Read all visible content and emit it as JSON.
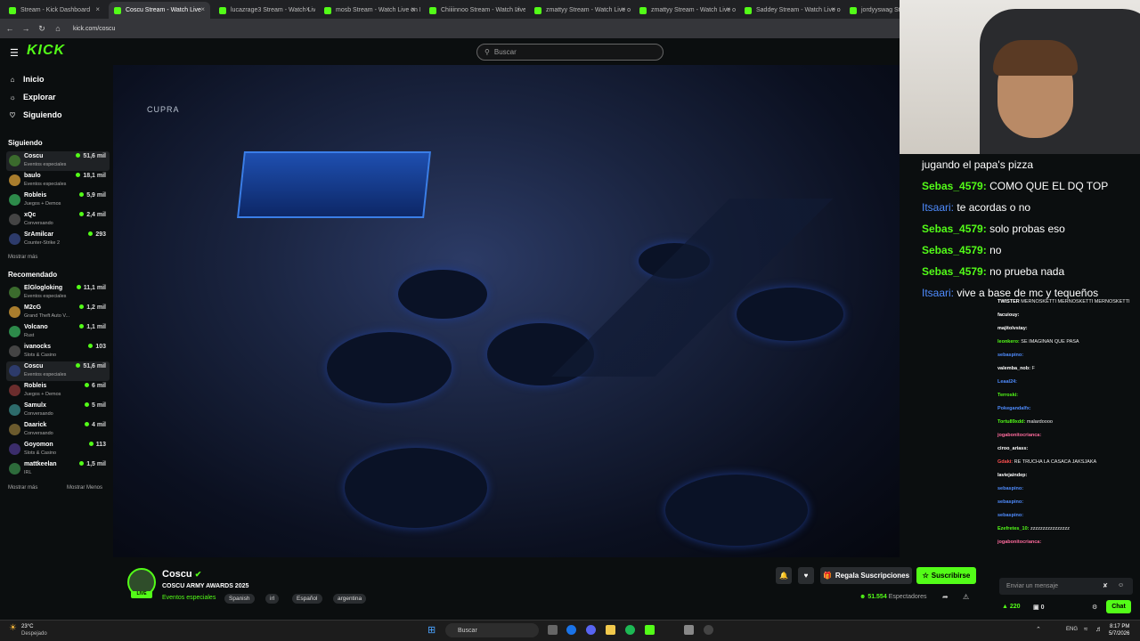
{
  "browser": {
    "tabs": [
      {
        "label": "Stream - Kick Dashboard",
        "active": false
      },
      {
        "label": "Coscu Stream - Watch Live",
        "active": true
      },
      {
        "label": "lucazrage3 Stream - Watch Live",
        "active": false
      },
      {
        "label": "mosb Stream - Watch Live on K",
        "active": false
      },
      {
        "label": "Chiiiinnoo Stream - Watch Live",
        "active": false
      },
      {
        "label": "zmattyy Stream - Watch Live o",
        "active": false
      },
      {
        "label": "zmattyy Stream - Watch Live o",
        "active": false
      },
      {
        "label": "Saddey Stream - Watch Live o",
        "active": false
      },
      {
        "label": "jordyyswag St",
        "active": false
      }
    ],
    "url": "kick.com/coscu"
  },
  "header": {
    "logo": "KICK",
    "search_placeholder": "Buscar"
  },
  "sidebar": {
    "nav": [
      {
        "label": "Inicio",
        "icon": "home-icon"
      },
      {
        "label": "Explorar",
        "icon": "compass-icon"
      },
      {
        "label": "Siguiendo",
        "icon": "heart-icon"
      }
    ],
    "following_title": "Siguiendo",
    "following": [
      {
        "name": "Coscu",
        "category": "Eventos especiales",
        "viewers": "51,6 mil",
        "selected": true
      },
      {
        "name": "baulo",
        "category": "Eventos especiales",
        "viewers": "18,1 mil"
      },
      {
        "name": "Robleis",
        "category": "Juegos + Demos",
        "viewers": "5,9 mil"
      },
      {
        "name": "xQc",
        "category": "Conversando",
        "viewers": "2,4 mil"
      },
      {
        "name": "SrAmilcar",
        "category": "Counter-Strike 2",
        "viewers": "293"
      }
    ],
    "show_more": "Mostrar más",
    "recommended_title": "Recomendado",
    "recommended": [
      {
        "name": "ElGlogloking",
        "category": "Eventos especiales",
        "viewers": "11,1 mil"
      },
      {
        "name": "M2cG",
        "category": "Grand Theft Auto V...",
        "viewers": "1,2 mil"
      },
      {
        "name": "Volcano",
        "category": "Rust",
        "viewers": "1,1 mil"
      },
      {
        "name": "ivanocks",
        "category": "Slots & Casino",
        "viewers": "103"
      },
      {
        "name": "Coscu",
        "category": "Eventos especiales",
        "viewers": "51,6 mil",
        "selected": true
      },
      {
        "name": "Robleis",
        "category": "Juegos + Demos",
        "viewers": "6 mil"
      },
      {
        "name": "Samulx",
        "category": "Conversando",
        "viewers": "5 mil"
      },
      {
        "name": "Daarick",
        "category": "Conversando",
        "viewers": "4 mil"
      },
      {
        "name": "Goyomon",
        "category": "Slots & Casino",
        "viewers": "113"
      },
      {
        "name": "mattkeelan",
        "category": "IRL",
        "viewers": "1,5 mil"
      }
    ],
    "show_more2": "Mostrar más",
    "show_less": "Mostrar Menos"
  },
  "video": {
    "watermark": "CUPRA"
  },
  "stream": {
    "name": "Coscu",
    "title": "COSCU ARMY AWARDS 2025",
    "category": "Eventos especiales",
    "tags": [
      "Spanish",
      "irl",
      "Español",
      "argentina"
    ],
    "gift_label": "Regala Suscripciones",
    "subscribe_label": "Suscribirse",
    "viewers": "51.554",
    "viewers_label": "Espectadores"
  },
  "chat_overlay": [
    {
      "user": "",
      "text": "jugando el papa's pizza"
    },
    {
      "user": "Sebas_4579:",
      "text": "COMO QUE EL DQ TOP"
    },
    {
      "user": "Itsaari:",
      "text": "te acordas o no"
    },
    {
      "user": "Sebas_4579:",
      "text": "solo probas eso"
    },
    {
      "user": "Sebas_4579:",
      "text": "no"
    },
    {
      "user": "Sebas_4579:",
      "text": "no prueba nada"
    },
    {
      "user": "Itsaari:",
      "text": "vive a base de mc y tequeños"
    }
  ],
  "chat": {
    "messages": [
      {
        "user": "TWISTER",
        "text": "MERNOSKETTI MERNOSKETTI MERNOSKETTI",
        "color": "#ffffff"
      },
      {
        "user": "facuiouy:",
        "text": "",
        "color": "#ffffff"
      },
      {
        "user": "majitolvstay:",
        "text": "",
        "color": "#ffffff"
      },
      {
        "user": "leonkero:",
        "text": "SE IMAGINAN QUE PASA",
        "color": "#53fc18"
      },
      {
        "user": "sebaspino:",
        "text": "",
        "color": "#4f8cff"
      },
      {
        "user": "valemba_nob:",
        "text": "F",
        "color": "#ffffff"
      },
      {
        "user": "Leaal24:",
        "text": "",
        "color": "#4f8cff"
      },
      {
        "user": "Terroski:",
        "text": "",
        "color": "#53fc18"
      },
      {
        "user": "Pokegandalfx:",
        "text": "",
        "color": "#4f8cff"
      },
      {
        "user": "Tortu89xdd:",
        "text": "malardoooo",
        "color": "#53fc18"
      },
      {
        "user": "jogabonitocrianca:",
        "text": "",
        "color": "#ff6b9d"
      },
      {
        "user": "ciroo_ariass:",
        "text": "",
        "color": "#ffffff"
      },
      {
        "user": "Gdaki:",
        "text": "RE TRUCHA LA CASACA JAKSJAKA",
        "color": "#ff5050"
      },
      {
        "user": "laviejaindep:",
        "text": "",
        "color": "#ffffff"
      },
      {
        "user": "sebaspino:",
        "text": "",
        "color": "#4f8cff"
      },
      {
        "user": "sebaspino:",
        "text": "",
        "color": "#4f8cff"
      },
      {
        "user": "sebaspino:",
        "text": "",
        "color": "#4f8cff"
      },
      {
        "user": "Ezefretes_10:",
        "text": "zzzzzzzzzzzzzzzz",
        "color": "#53fc18"
      },
      {
        "user": "jogabonitocrianca:",
        "text": "",
        "color": "#ff6b9d"
      }
    ],
    "input_placeholder": "Enviar un mensaje",
    "points": "220",
    "count": "0",
    "send_label": "Chat"
  },
  "taskbar": {
    "weather_temp": "23°C",
    "weather_desc": "Despejado",
    "search": "Buscar",
    "lang": "ENG",
    "time": "8:17 PM",
    "date": "5/7/2026"
  }
}
